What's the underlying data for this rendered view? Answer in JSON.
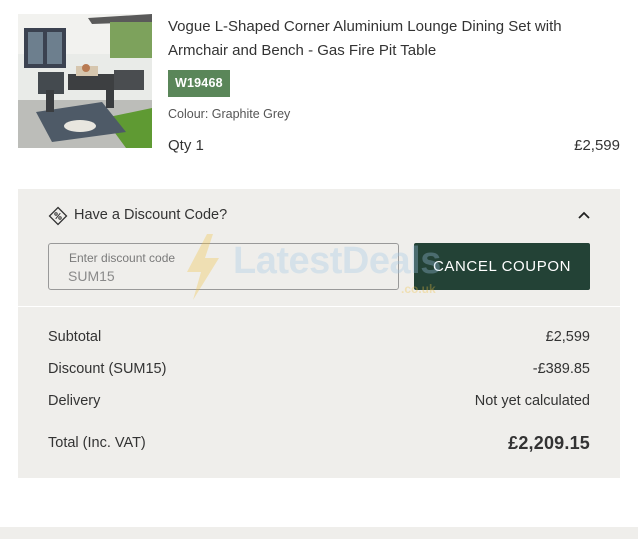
{
  "product": {
    "title": "Vogue L-Shaped Corner Aluminium Lounge Dining Set with Armchair and Bench - Gas Fire Pit Table",
    "sku": "W19468",
    "colour": "Colour: Graphite Grey",
    "qty": "Qty 1",
    "price": "£2,599",
    "image_icon": "outdoor-furniture-photo"
  },
  "discount": {
    "heading": "Have a Discount Code?",
    "field_label": "Enter discount code",
    "code_value": "SUM15",
    "cancel_label": "CANCEL COUPON",
    "expanded": true
  },
  "totals": {
    "subtotal_label": "Subtotal",
    "subtotal_value": "£2,599",
    "discount_label": "Discount (SUM15)",
    "discount_value": "-£389.85",
    "delivery_label": "Delivery",
    "delivery_value": "Not yet calculated",
    "total_label": "Total (Inc. VAT)",
    "total_value": "£2,209.15"
  },
  "watermark": {
    "text": "LatestDeals",
    "sub": ".co.uk"
  },
  "colors": {
    "sku_badge": "#5a8659",
    "cancel_button": "#234236",
    "panel_bg": "#efeeeb"
  }
}
